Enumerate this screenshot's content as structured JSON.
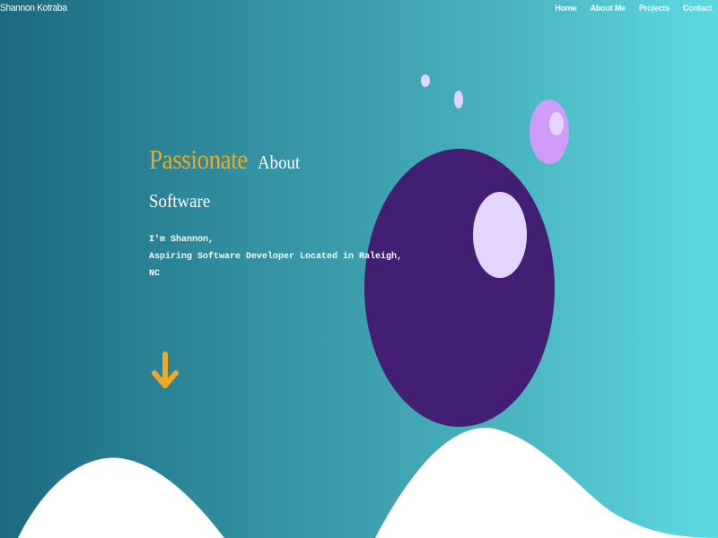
{
  "header": {
    "brand": "Shannon Kotraba",
    "nav": [
      {
        "label": "Home"
      },
      {
        "label": "About Me"
      },
      {
        "label": "Projects"
      },
      {
        "label": "Contact"
      }
    ]
  },
  "hero": {
    "headline_accent": "Passionate",
    "headline_rest": "About",
    "headline_line2": "Software",
    "intro_line1": "I'm Shannon,",
    "intro_line2": "Aspiring Software Developer Located in Raleigh,",
    "intro_line3": "NC"
  },
  "icons": {
    "scroll": "arrow-down-icon"
  },
  "colors": {
    "gradient_start": "#1c6a7f",
    "gradient_end": "#5dd9e0",
    "accent": "#f0a826",
    "planet": "#431f73",
    "bubble_light": "#e4d5ff",
    "bubble_lilac": "#cf9df9",
    "white": "#ffffff"
  }
}
